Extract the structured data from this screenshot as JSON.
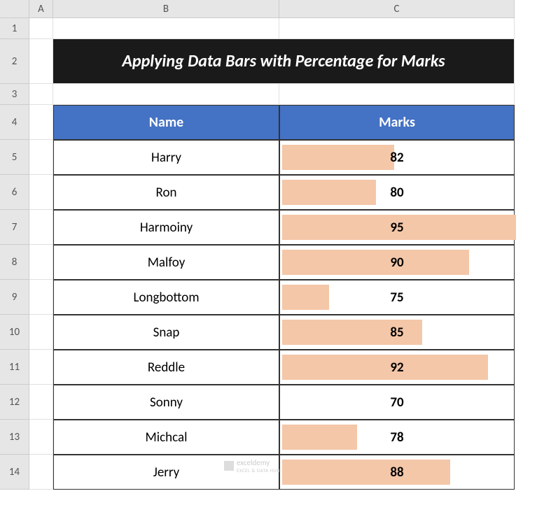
{
  "columns": [
    "A",
    "B",
    "C"
  ],
  "rows": [
    "1",
    "2",
    "3",
    "4",
    "5",
    "6",
    "7",
    "8",
    "9",
    "10",
    "11",
    "12",
    "13",
    "14"
  ],
  "title": "Applying Data Bars with Percentage for Marks",
  "headers": {
    "name": "Name",
    "marks": "Marks"
  },
  "data": [
    {
      "name": "Harry",
      "marks": 82,
      "barPct": 48
    },
    {
      "name": "Ron",
      "marks": 80,
      "barPct": 40
    },
    {
      "name": "Harmoiny",
      "marks": 95,
      "barPct": 100
    },
    {
      "name": "Malfoy",
      "marks": 90,
      "barPct": 80
    },
    {
      "name": "Longbottom",
      "marks": 75,
      "barPct": 20
    },
    {
      "name": "Snap",
      "marks": 85,
      "barPct": 60
    },
    {
      "name": "Reddle",
      "marks": 92,
      "barPct": 88
    },
    {
      "name": "Sonny",
      "marks": 70,
      "barPct": 0
    },
    {
      "name": "Michcal",
      "marks": 78,
      "barPct": 32
    },
    {
      "name": "Jerry",
      "marks": 88,
      "barPct": 72
    }
  ],
  "watermark": {
    "main": "exceldemy",
    "sub": "EXCEL & DATA HUB"
  },
  "chart_data": {
    "type": "table",
    "title": "Applying Data Bars with Percentage for Marks",
    "columns": [
      "Name",
      "Marks"
    ],
    "rows": [
      [
        "Harry",
        82
      ],
      [
        "Ron",
        80
      ],
      [
        "Harmoiny",
        95
      ],
      [
        "Malfoy",
        90
      ],
      [
        "Longbottom",
        75
      ],
      [
        "Snap",
        85
      ],
      [
        "Reddle",
        92
      ],
      [
        "Sonny",
        70
      ],
      [
        "Michcal",
        78
      ],
      [
        "Jerry",
        88
      ]
    ]
  }
}
